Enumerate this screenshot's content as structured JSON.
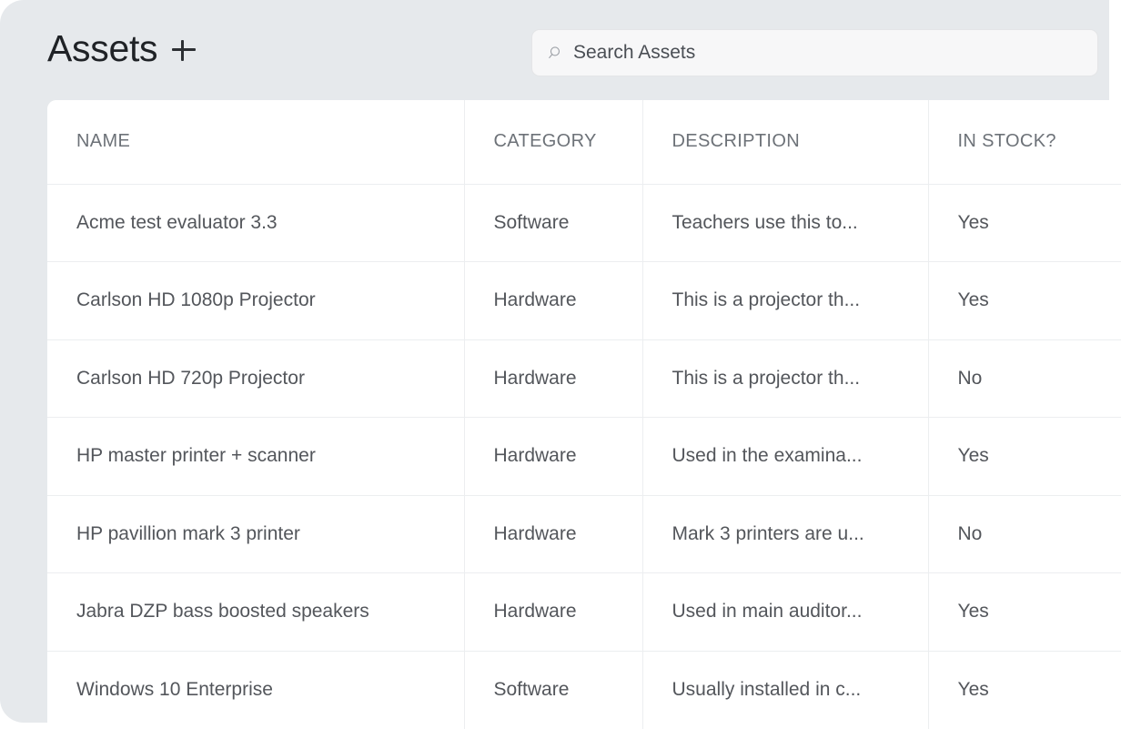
{
  "header": {
    "title": "Assets",
    "add_label": "+",
    "add_icon": "plus-icon"
  },
  "search": {
    "placeholder": "Search Assets",
    "value": "",
    "icon": "search-icon"
  },
  "table": {
    "columns": [
      "NAME",
      "CATEGORY",
      "DESCRIPTION",
      "IN STOCK?"
    ],
    "rows": [
      {
        "name": "Acme test evaluator 3.3",
        "category": "Software",
        "description": "Teachers use this to...",
        "in_stock": "Yes"
      },
      {
        "name": "Carlson HD 1080p Projector",
        "category": "Hardware",
        "description": "This is a projector th...",
        "in_stock": "Yes"
      },
      {
        "name": "Carlson HD 720p Projector",
        "category": "Hardware",
        "description": "This is a projector th...",
        "in_stock": "No"
      },
      {
        "name": "HP master printer + scanner",
        "category": "Hardware",
        "description": "Used in the examina...",
        "in_stock": "Yes"
      },
      {
        "name": "HP pavillion mark 3 printer",
        "category": "Hardware",
        "description": "Mark 3 printers are u...",
        "in_stock": "No"
      },
      {
        "name": "Jabra DZP bass boosted speakers",
        "category": "Hardware",
        "description": "Used in main auditor...",
        "in_stock": "Yes"
      },
      {
        "name": "Windows 10 Enterprise",
        "category": "Software",
        "description": "Usually installed in c...",
        "in_stock": "Yes"
      }
    ]
  },
  "colors": {
    "page_background": "#e6e9ec",
    "card_background": "#ffffff",
    "grid_line": "#eceef0",
    "header_text": "#6d7278",
    "body_text": "#53565b",
    "title_text": "#1f2226",
    "search_field": "#f7f7f8"
  }
}
